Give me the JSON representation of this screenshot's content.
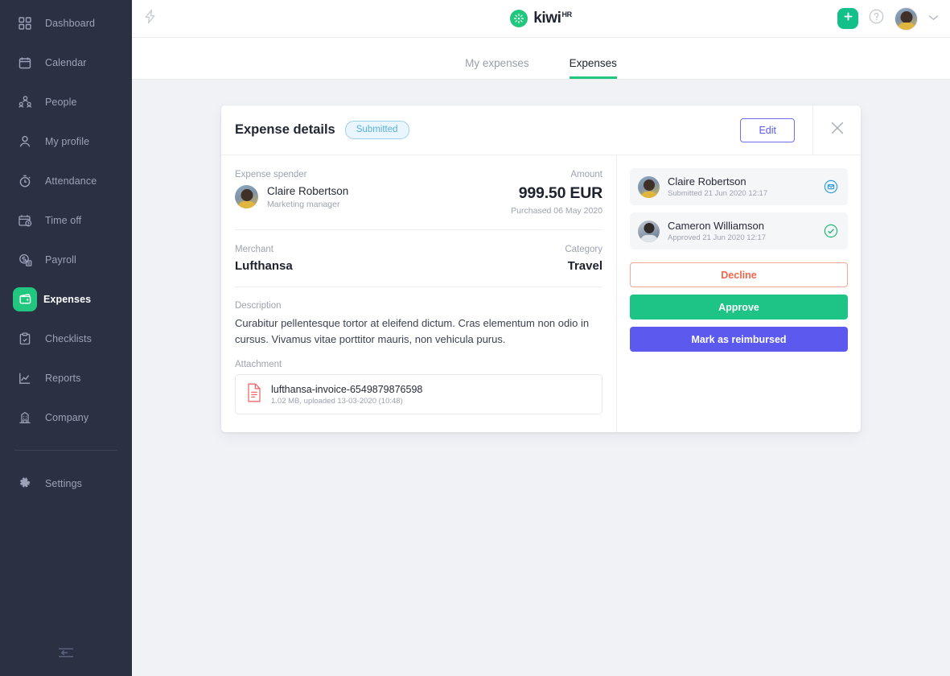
{
  "sidebar": {
    "items": [
      {
        "label": "Dashboard",
        "icon": "grid-icon",
        "active": false
      },
      {
        "label": "Calendar",
        "icon": "calendar-icon",
        "active": false
      },
      {
        "label": "People",
        "icon": "people-icon",
        "active": false
      },
      {
        "label": "My profile",
        "icon": "user-icon",
        "active": false
      },
      {
        "label": "Attendance",
        "icon": "stopwatch-icon",
        "active": false
      },
      {
        "label": "Time off",
        "icon": "calendar-clock-icon",
        "active": false
      },
      {
        "label": "Payroll",
        "icon": "payroll-icon",
        "active": false
      },
      {
        "label": "Expenses",
        "icon": "wallet-icon",
        "active": true
      },
      {
        "label": "Checklists",
        "icon": "clipboard-check-icon",
        "active": false
      },
      {
        "label": "Reports",
        "icon": "chart-line-icon",
        "active": false
      },
      {
        "label": "Company",
        "icon": "building-icon",
        "active": false
      }
    ],
    "settings": {
      "label": "Settings",
      "icon": "gear-icon"
    },
    "collapse": {
      "icon": "collapse-left-icon"
    },
    "colors": {
      "background": "#2b3042",
      "text": "#9ca3b8",
      "active_badge": "#22c77f"
    }
  },
  "topbar": {
    "bolt_icon": "lightning-bolt-icon",
    "brand": {
      "mark": "kiwi-circle-logo",
      "name": "kiwi",
      "superscript": "HR"
    },
    "add_button": {
      "icon": "plus-icon",
      "label": "+"
    },
    "help_button": {
      "icon": "question-circle-icon"
    },
    "avatar": {
      "name": "user-avatar"
    },
    "chevron": {
      "icon": "chevron-down-icon"
    }
  },
  "tabs": [
    {
      "label": "My expenses",
      "active": false
    },
    {
      "label": "Expenses",
      "active": true
    }
  ],
  "card": {
    "title": "Expense details",
    "status": "Submitted",
    "edit_label": "Edit",
    "close_icon": "close-icon"
  },
  "expense": {
    "spender_label": "Expense spender",
    "spender_name": "Claire Robertson",
    "spender_role": "Marketing manager",
    "amount_label": "Amount",
    "amount": "999.50 EUR",
    "purchased": "Purchased 06 May 2020",
    "merchant_label": "Merchant",
    "merchant": "Lufthansa",
    "category_label": "Category",
    "category": "Travel",
    "description_label": "Description",
    "description": "Curabitur pellentesque tortor at eleifend dictum. Cras elementum non odio in cursus. Vivamus vitae porttitor mauris, non vehicula purus.",
    "attachment_label": "Attachment",
    "attachment": {
      "icon": "file-document-icon",
      "name": "lufthansa-invoice-6549879876598",
      "meta": "1.02 MB, uploaded 13-03-2020 (10:48)"
    }
  },
  "approvals": {
    "people": [
      {
        "name": "Claire Robertson",
        "meta": "Submitted 21 Jun 2020 12:17",
        "status_icon": "submitted-envelope-icon",
        "status_color": "#2b9fe0"
      },
      {
        "name": "Cameron Williamson",
        "meta": "Approved 21 Jun 2020 12:17",
        "status_icon": "check-circle-icon",
        "status_color": "#22b573"
      }
    ],
    "actions": [
      {
        "label": "Decline",
        "style": "decline",
        "color": "#f4664a"
      },
      {
        "label": "Approve",
        "style": "approve",
        "color": "#1dc486"
      },
      {
        "label": "Mark as reimbursed",
        "style": "reimburse",
        "color": "#5b59ee"
      }
    ]
  }
}
